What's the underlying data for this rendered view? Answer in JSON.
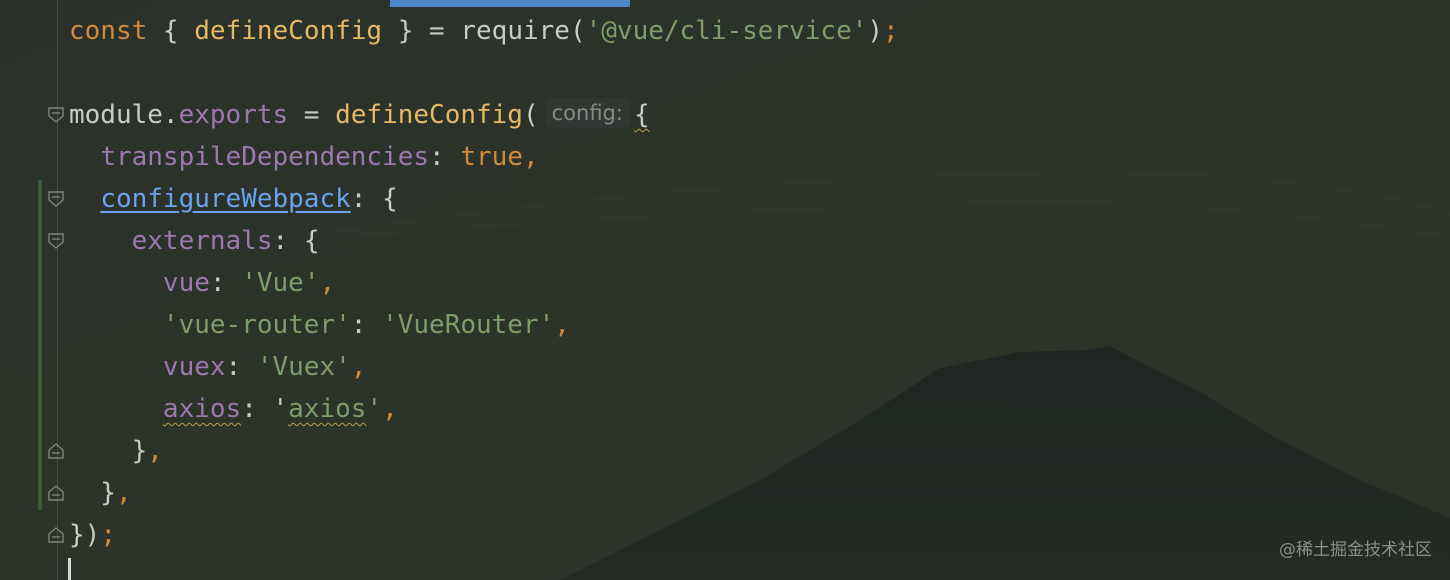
{
  "editor": {
    "lines": [
      [
        {
          "t": "const",
          "c": "kw"
        },
        {
          "t": " { "
        },
        {
          "t": "defineConfig",
          "c": "fn"
        },
        {
          "t": " } = "
        },
        {
          "t": "require",
          "c": "fn-plain"
        },
        {
          "t": "("
        },
        {
          "t": "'@vue/cli-service'",
          "c": "str"
        },
        {
          "t": ")"
        },
        {
          "t": ";",
          "c": "kw"
        }
      ],
      [],
      [
        {
          "t": "module"
        },
        {
          "t": "."
        },
        {
          "t": "exports",
          "c": "prop"
        },
        {
          "t": " = "
        },
        {
          "t": "defineConfig",
          "c": "fn"
        },
        {
          "t": "("
        },
        {
          "t": "config:",
          "c": "hint"
        },
        {
          "t": "{",
          "c": "squig"
        }
      ],
      [
        {
          "t": "  "
        },
        {
          "t": "transpileDependencies",
          "c": "prop"
        },
        {
          "t": ": "
        },
        {
          "t": "true",
          "c": "kw"
        },
        {
          "t": ",",
          "c": "kw"
        }
      ],
      [
        {
          "t": "  "
        },
        {
          "t": "configureWebpack",
          "c": "link"
        },
        {
          "t": ": {"
        }
      ],
      [
        {
          "t": "    "
        },
        {
          "t": "externals",
          "c": "prop"
        },
        {
          "t": ": {"
        }
      ],
      [
        {
          "t": "      "
        },
        {
          "t": "vue",
          "c": "prop"
        },
        {
          "t": ": "
        },
        {
          "t": "'Vue'",
          "c": "str"
        },
        {
          "t": ",",
          "c": "kw"
        }
      ],
      [
        {
          "t": "      "
        },
        {
          "t": "'vue-router'",
          "c": "str"
        },
        {
          "t": ": "
        },
        {
          "t": "'VueRouter'",
          "c": "str"
        },
        {
          "t": ",",
          "c": "kw"
        }
      ],
      [
        {
          "t": "      "
        },
        {
          "t": "vuex",
          "c": "prop"
        },
        {
          "t": ": "
        },
        {
          "t": "'Vuex'",
          "c": "str"
        },
        {
          "t": ",",
          "c": "kw"
        }
      ],
      [
        {
          "t": "      "
        },
        {
          "t": "axios",
          "c": "prop squig"
        },
        {
          "t": ": "
        },
        {
          "t": "'"
        },
        {
          "t": "axios",
          "c": "str squig"
        },
        {
          "t": "'",
          "c": "str"
        },
        {
          "t": ",",
          "c": "kw"
        }
      ],
      [
        {
          "t": "    }"
        },
        {
          "t": ",",
          "c": "kw"
        }
      ],
      [
        {
          "t": "  }"
        },
        {
          "t": ",",
          "c": "kw"
        }
      ],
      [
        {
          "t": "})"
        },
        {
          "t": ";",
          "c": "kw"
        }
      ]
    ]
  },
  "colors": {
    "keyword": "#d08a3a",
    "function": "#e5b964",
    "string": "#7f9d69",
    "property": "#9d78ad",
    "link": "#6aa2ec",
    "text": "#c9ccc6",
    "background": "#262d27"
  },
  "fold_icons": [
    "fold-open-icon",
    "fold-open-icon",
    "fold-open-icon",
    "fold-close-icon",
    "fold-close-icon",
    "fold-close-icon"
  ],
  "watermark": "@稀土掘金技术社区"
}
